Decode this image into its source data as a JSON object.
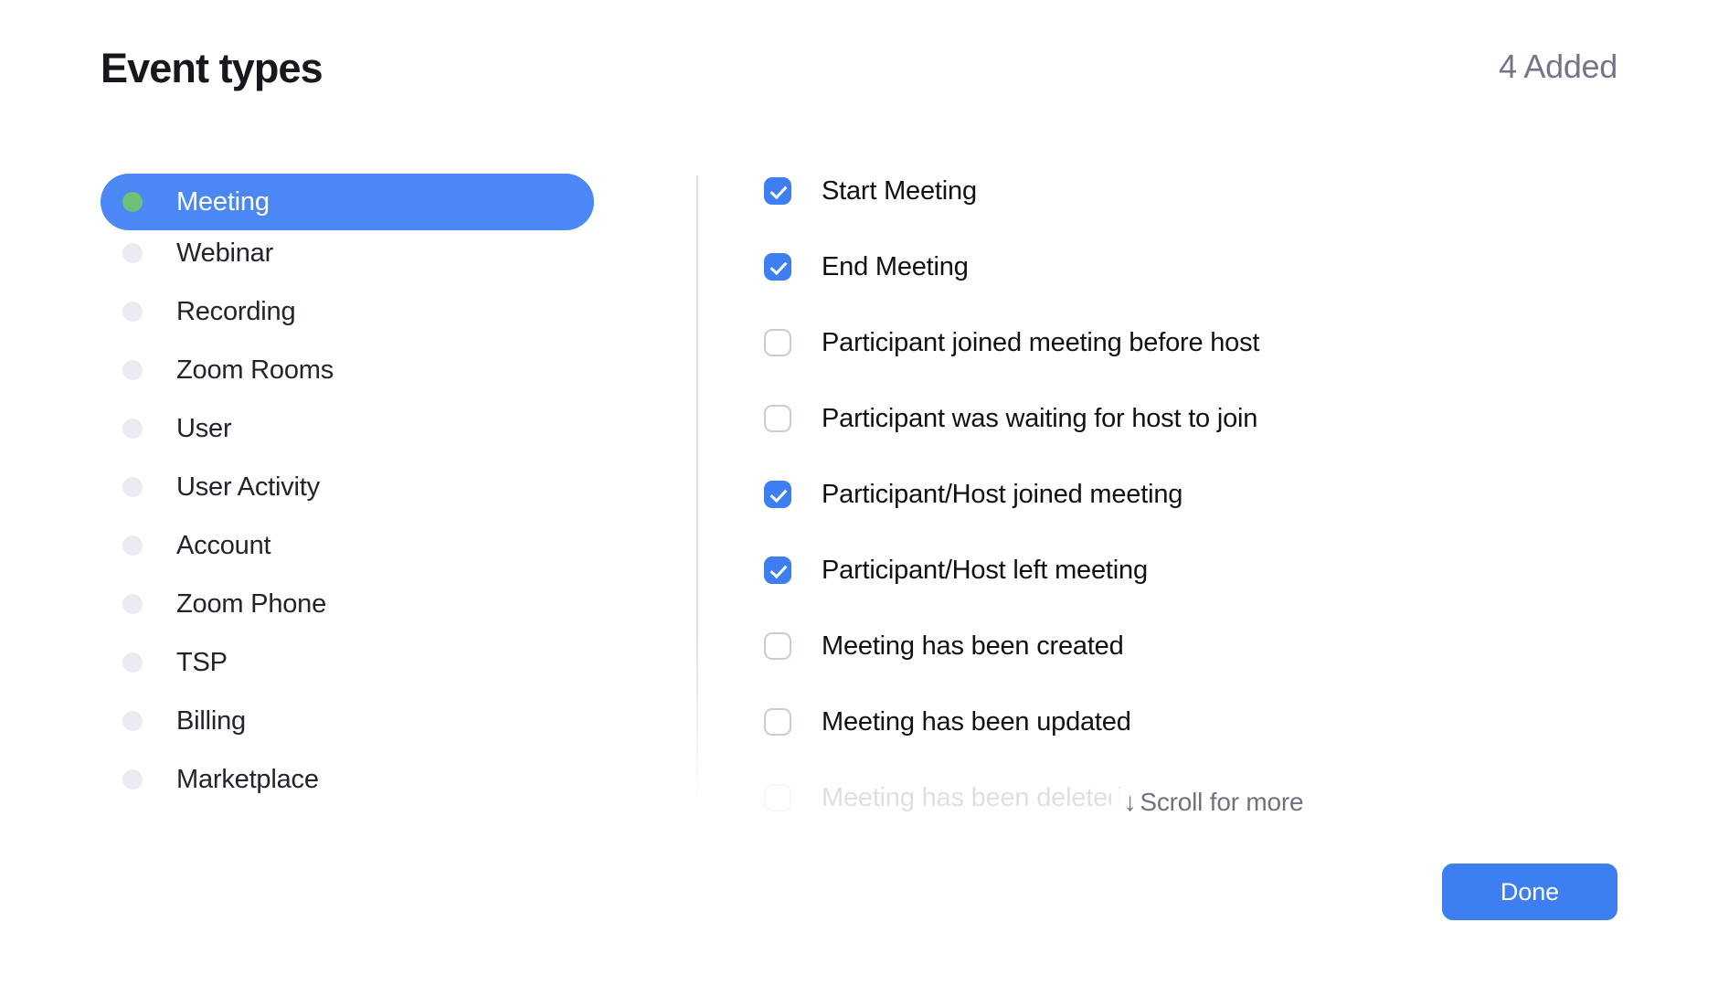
{
  "header": {
    "title": "Event types",
    "added_count_label": "4 Added"
  },
  "categories": {
    "selected": "Meeting",
    "items": [
      {
        "label": "Meeting",
        "selected": true,
        "dot_color": "#6ec077"
      },
      {
        "label": "Webinar",
        "selected": false,
        "dot_color": "#eaebf0"
      },
      {
        "label": "Recording",
        "selected": false,
        "dot_color": "#eaebf0"
      },
      {
        "label": "Zoom Rooms",
        "selected": false,
        "dot_color": "#eaebf0"
      },
      {
        "label": "User",
        "selected": false,
        "dot_color": "#eaebf0"
      },
      {
        "label": "User Activity",
        "selected": false,
        "dot_color": "#eaebf0"
      },
      {
        "label": "Account",
        "selected": false,
        "dot_color": "#eaebf0"
      },
      {
        "label": "Zoom Phone",
        "selected": false,
        "dot_color": "#eaebf0"
      },
      {
        "label": "TSP",
        "selected": false,
        "dot_color": "#eaebf0"
      },
      {
        "label": "Billing",
        "selected": false,
        "dot_color": "#eaebf0"
      },
      {
        "label": "Marketplace",
        "selected": false,
        "dot_color": "#eaebf0"
      }
    ]
  },
  "events": {
    "items": [
      {
        "label": "Start Meeting",
        "checked": true,
        "faded": false
      },
      {
        "label": "End Meeting",
        "checked": true,
        "faded": false
      },
      {
        "label": "Participant joined meeting before host",
        "checked": false,
        "faded": false
      },
      {
        "label": "Participant was waiting for host to join",
        "checked": false,
        "faded": false
      },
      {
        "label": "Participant/Host joined meeting",
        "checked": true,
        "faded": false
      },
      {
        "label": "Participant/Host left meeting",
        "checked": true,
        "faded": false
      },
      {
        "label": "Meeting has been created",
        "checked": false,
        "faded": false
      },
      {
        "label": "Meeting has been updated",
        "checked": false,
        "faded": false
      },
      {
        "label": "Meeting has been deleted",
        "checked": false,
        "faded": true
      }
    ],
    "scroll_hint": {
      "arrow": "↓",
      "label": "Scroll for more"
    }
  },
  "footer": {
    "done_label": "Done"
  },
  "colors": {
    "accent_blue": "#3d7ef0",
    "selected_pill_blue": "#4b88f5",
    "active_dot_green": "#6ec077",
    "inactive_dot_gray": "#eaebf0",
    "muted_text": "#73758a",
    "divider": "#dcdeeb"
  }
}
